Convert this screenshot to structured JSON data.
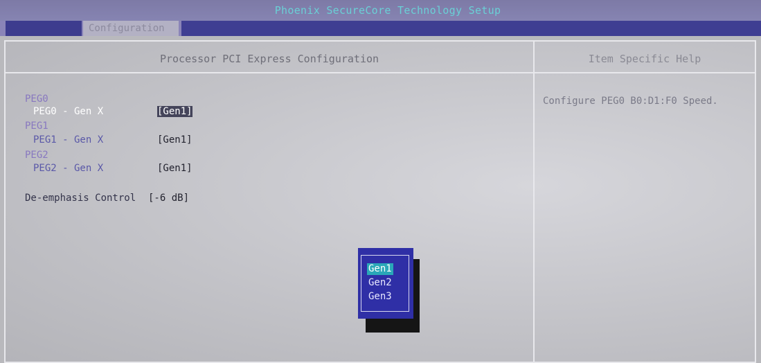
{
  "window": {
    "title": "Phoenix SecureCore Technology Setup"
  },
  "tabs": [
    {
      "label": "Configuration"
    }
  ],
  "main_pane": {
    "title": "Processor PCI Express Configuration",
    "items": [
      {
        "group": "PEG0",
        "label": "PEG0 - Gen X",
        "value": "[Gen1]",
        "selected": true
      },
      {
        "group": "PEG1",
        "label": "PEG1 - Gen X",
        "value": "[Gen1]",
        "selected": false
      },
      {
        "group": "PEG2",
        "label": "PEG2 - Gen X",
        "value": "[Gen1]",
        "selected": false
      }
    ],
    "deemphasis": {
      "label": "De-emphasis Control",
      "value": "[-6 dB]"
    }
  },
  "help_pane": {
    "title": "Item Specific Help",
    "text": "Configure PEG0 B0:D1:F0 Speed."
  },
  "popup": {
    "options": [
      "Gen1",
      "Gen2",
      "Gen3"
    ],
    "selected_index": 0
  },
  "colors": {
    "popup_bg": "#2f2fa6",
    "popup_highlight": "#2aa7b8",
    "tab_strip": "#3f3e92"
  }
}
